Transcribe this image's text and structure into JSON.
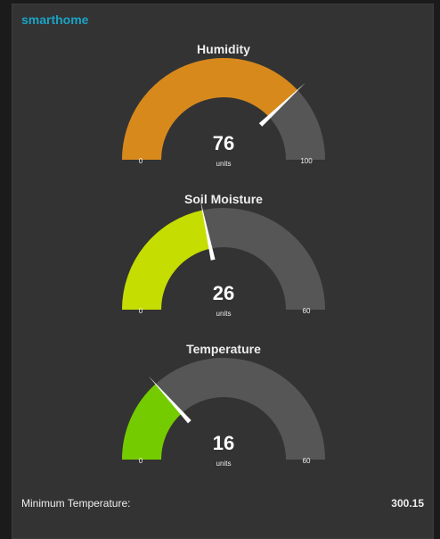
{
  "panel": {
    "title": "smarthome"
  },
  "gauges": [
    {
      "title": "Humidity",
      "value": 76,
      "min": 0,
      "max": 100,
      "units": "units",
      "color": "#d8891c",
      "track_color": "#565656"
    },
    {
      "title": "Soil Moisture",
      "value": 26,
      "min": 0,
      "max": 60,
      "units": "units",
      "color": "#c5dd00",
      "track_color": "#565656"
    },
    {
      "title": "Temperature",
      "value": 16,
      "min": 0,
      "max": 60,
      "units": "units",
      "color": "#74cc00",
      "track_color": "#565656"
    }
  ],
  "info": {
    "label": "Minimum Temperature:",
    "value": "300.15"
  }
}
